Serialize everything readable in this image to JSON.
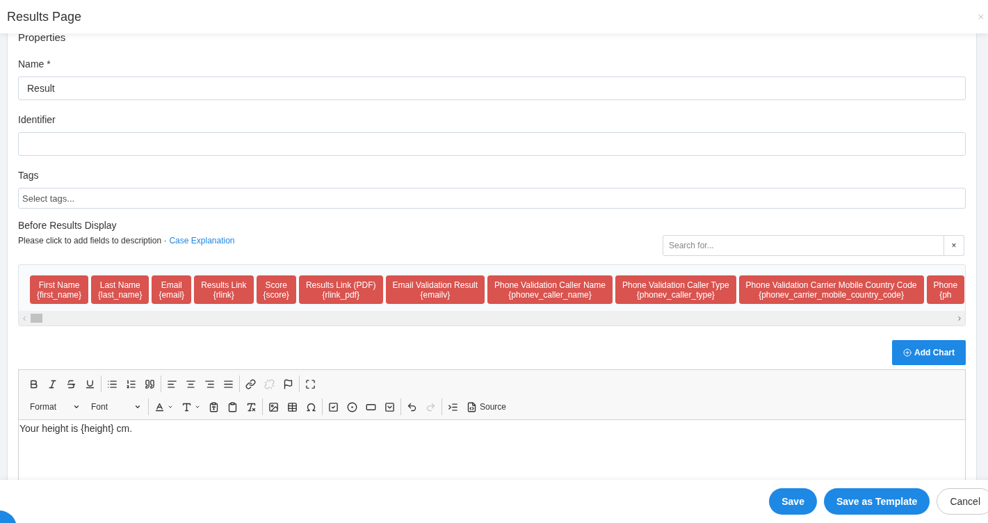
{
  "modal": {
    "title": "Results Page"
  },
  "section_title": "Properties",
  "fields": [
    {
      "label": "Name *",
      "value": "Result"
    },
    {
      "label": "Identifier"
    }
  ],
  "tags": {
    "label": "Tags",
    "placeholder": "Select tags..."
  },
  "before_results": {
    "label": "Before Results Display",
    "hint": "Please click to add fields to description ·",
    "link": "Case Explanation",
    "search_placeholder": "Search for...",
    "clear": "×"
  },
  "field_chips": [
    {
      "label": "First Name",
      "code": "{first_name}"
    },
    {
      "label": "Last Name",
      "code": "{last_name}"
    },
    {
      "label": "Email",
      "code": "{email}"
    },
    {
      "label": "Results Link",
      "code": "{rlink}"
    },
    {
      "label": "Score",
      "code": "{score}"
    },
    {
      "label": "Results Link (PDF)",
      "code": "{rlink_pdf}"
    },
    {
      "label": "Email Validation Result",
      "code": "{emailv}"
    },
    {
      "label": "Phone Validation Caller Name",
      "code": "{phonev_caller_name}"
    },
    {
      "label": "Phone Validation Caller Type",
      "code": "{phonev_caller_type}"
    },
    {
      "label": "Phone Validation Carrier Mobile Country Code",
      "code": "{phonev_carrier_mobile_country_code}"
    },
    {
      "label": "Phone",
      "code": "{ph"
    }
  ],
  "add_chart": "Add Chart",
  "toolbar_rows": [
    [
      [
        {
          "kind": "bold",
          "disabled": false
        },
        {
          "kind": "italic",
          "disabled": false
        },
        {
          "kind": "strike",
          "disabled": false
        },
        {
          "kind": "underline",
          "disabled": false
        }
      ],
      [
        {
          "kind": "bullets",
          "disabled": false
        },
        {
          "kind": "numbers",
          "disabled": false
        },
        {
          "kind": "quote",
          "disabled": false
        }
      ],
      [
        {
          "kind": "align-left",
          "disabled": false
        },
        {
          "kind": "align-center",
          "disabled": false
        },
        {
          "kind": "align-right",
          "disabled": false
        },
        {
          "kind": "justify",
          "disabled": false
        }
      ],
      [
        {
          "kind": "link",
          "disabled": false
        },
        {
          "kind": "unlink",
          "disabled": true
        },
        {
          "kind": "flag",
          "disabled": false
        }
      ],
      [
        {
          "kind": "maximize",
          "disabled": false
        }
      ]
    ],
    [
      [
        {
          "kind": "dropdown",
          "label": "Format",
          "disabled": false
        },
        {
          "kind": "dropdown",
          "label": "Font",
          "disabled": false
        }
      ],
      [
        {
          "kind": "text-color",
          "disabled": false
        },
        {
          "kind": "bg-color",
          "disabled": false
        },
        {
          "kind": "paste-text",
          "disabled": false
        },
        {
          "kind": "paste-word",
          "disabled": false
        },
        {
          "kind": "clear-format",
          "disabled": false
        }
      ],
      [
        {
          "kind": "image",
          "disabled": false
        },
        {
          "kind": "table",
          "disabled": false
        },
        {
          "kind": "omega",
          "disabled": false
        }
      ],
      [
        {
          "kind": "checkbox",
          "disabled": false
        },
        {
          "kind": "radio",
          "disabled": false
        },
        {
          "kind": "textfield",
          "disabled": false
        },
        {
          "kind": "select",
          "disabled": false
        }
      ],
      [
        {
          "kind": "undo",
          "disabled": false
        },
        {
          "kind": "redo",
          "disabled": true
        }
      ],
      [
        {
          "kind": "indent",
          "disabled": false
        },
        {
          "kind": "source",
          "label": "Source",
          "disabled": false
        }
      ]
    ]
  ],
  "editor_text": "Your height is {height} cm.",
  "footer_buttons": [
    {
      "label": "Save",
      "kind": "primary"
    },
    {
      "label": "Save as Template",
      "kind": "primary"
    },
    {
      "label": "Cancel",
      "kind": "outline"
    }
  ]
}
